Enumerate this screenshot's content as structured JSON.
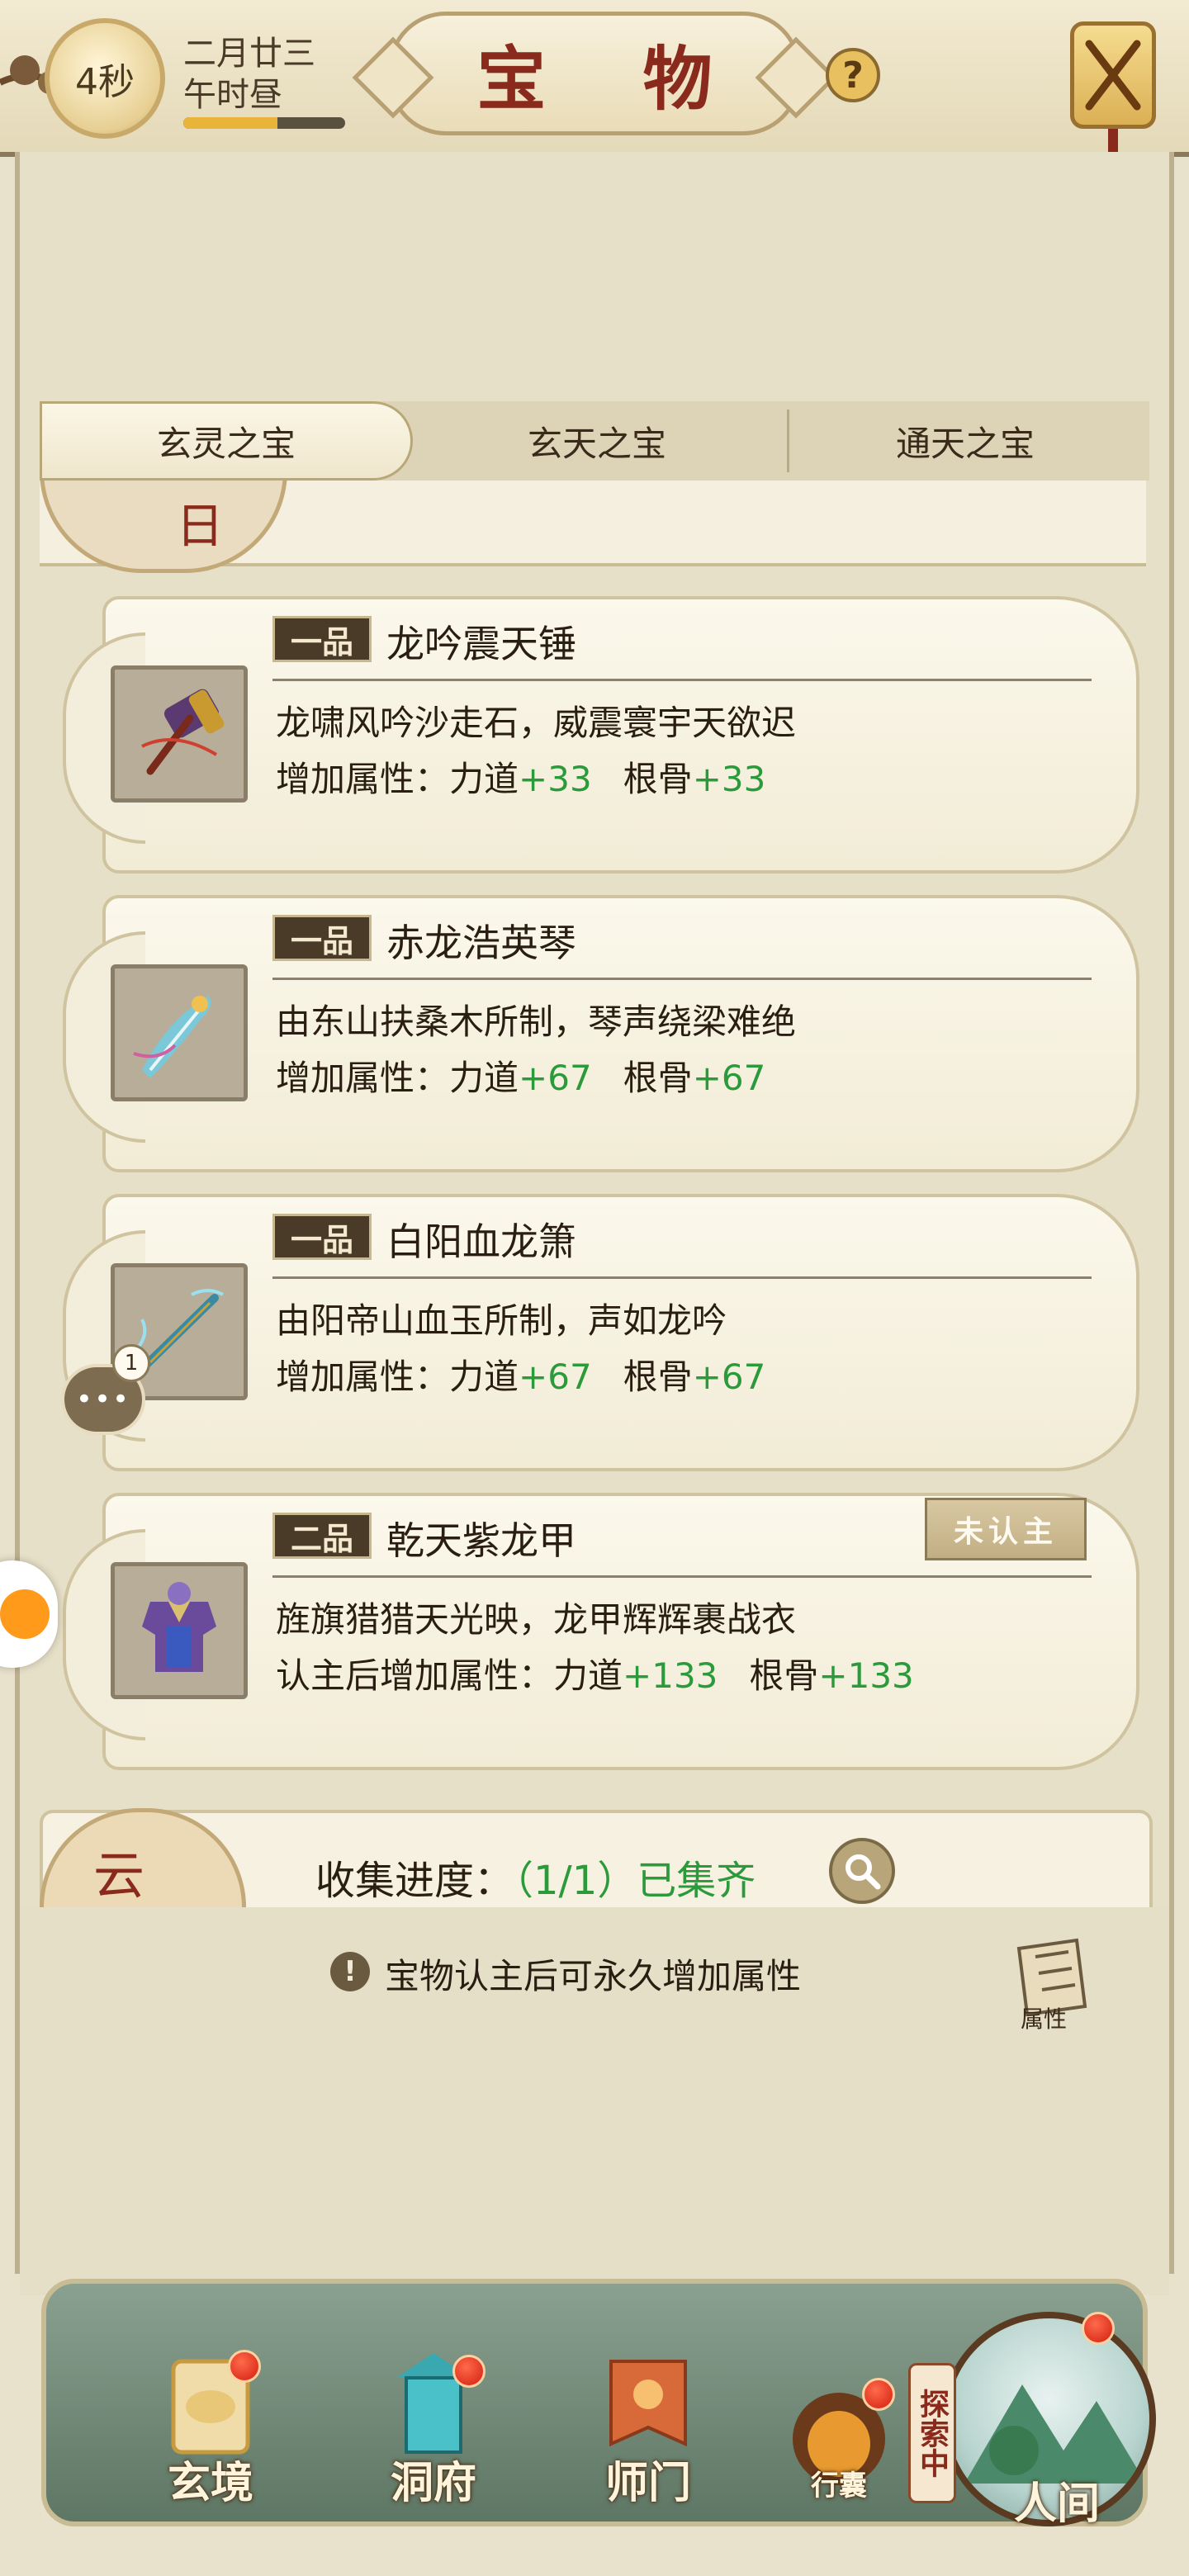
{
  "header": {
    "timer": "4秒",
    "date_line1": "二月廿三",
    "date_line2": "午时昼",
    "time_progress": 0.58,
    "title": "宝 物",
    "help_symbol": "?"
  },
  "tabs": [
    {
      "label": "玄灵之宝",
      "active": true
    },
    {
      "label": "玄天之宝",
      "active": false
    },
    {
      "label": "通天之宝",
      "active": false
    }
  ],
  "list_top_medallion": "日",
  "items": [
    {
      "grade": "一品",
      "name": "龙吟震天锤",
      "desc": "龙啸风吟沙走石，威震寰宇天欲迟",
      "attr_prefix": "增加属性：",
      "attr1_name": "力道",
      "attr1_value": "+33",
      "attr2_name": "根骨",
      "attr2_value": "+33",
      "icon": "hammer-icon"
    },
    {
      "grade": "一品",
      "name": "赤龙浩英琴",
      "desc": "由东山扶桑木所制，琴声绕梁难绝",
      "attr_prefix": "增加属性：",
      "attr1_name": "力道",
      "attr1_value": "+67",
      "attr2_name": "根骨",
      "attr2_value": "+67",
      "icon": "zither-icon"
    },
    {
      "grade": "一品",
      "name": "白阳血龙箫",
      "desc": "由阳帝山血玉所制，声如龙吟",
      "attr_prefix": "增加属性：",
      "attr1_name": "力道",
      "attr1_value": "+67",
      "attr2_name": "根骨",
      "attr2_value": "+67",
      "icon": "flute-icon"
    },
    {
      "grade": "二品",
      "name": "乾天紫龙甲",
      "desc": "旌旗猎猎天光映，龙甲辉辉裹战衣",
      "attr_prefix": "认主后增加属性：",
      "attr1_name": "力道",
      "attr1_value": "+133",
      "attr2_name": "根骨",
      "attr2_value": "+133",
      "icon": "armor-icon",
      "badge": "未认主"
    }
  ],
  "chat": {
    "count": "1",
    "dots": "•••"
  },
  "collection": {
    "medallion": "云",
    "label": "收集进度：",
    "count": "（1/1）",
    "status": "已集齐"
  },
  "tip": {
    "icon_symbol": "!",
    "text": "宝物认主后可永久增加属性",
    "attr_button_label": "属性"
  },
  "nav": {
    "items": [
      "玄境",
      "洞府",
      "师门",
      "行囊",
      "人间"
    ],
    "explore_tag": "探索中"
  },
  "colors": {
    "accent_red": "#8a2a1c",
    "attr_green": "#2a9a3a",
    "notify_red": "#d21e10"
  }
}
